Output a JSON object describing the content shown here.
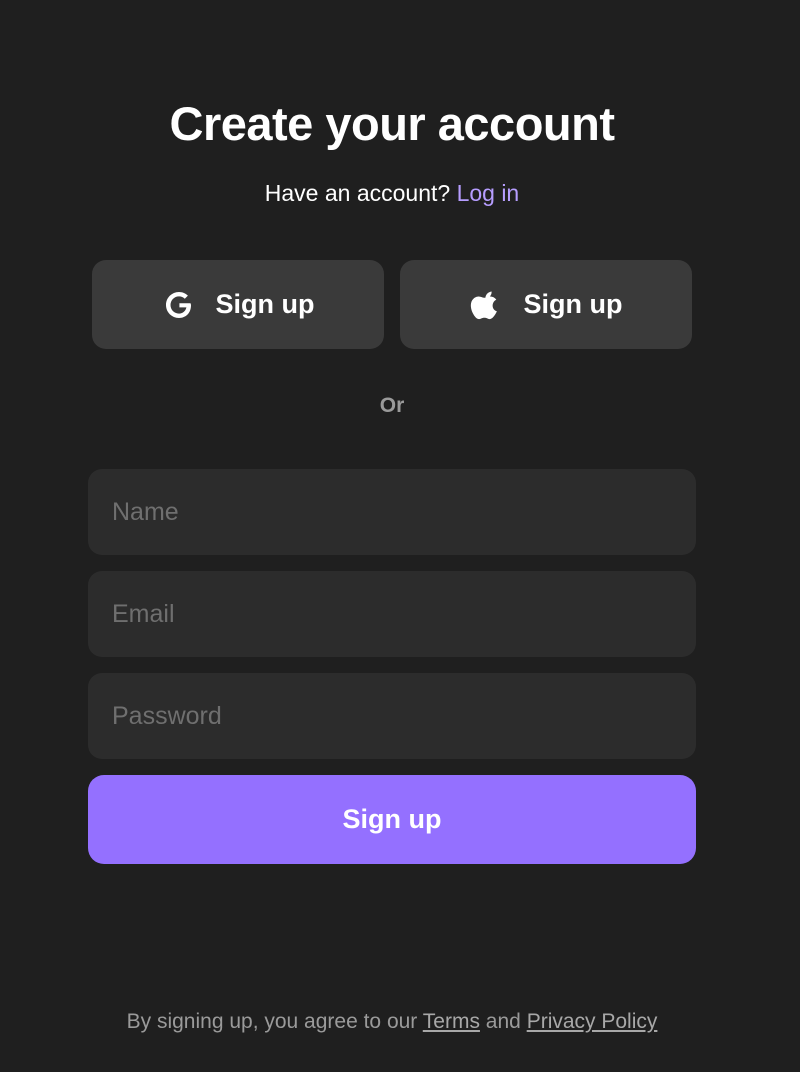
{
  "header": {
    "title": "Create your account",
    "subtitle_prefix": "Have an account?",
    "login_link": "Log in"
  },
  "social": {
    "google": {
      "label": "Sign up",
      "icon": "google-icon"
    },
    "apple": {
      "label": "Sign up",
      "icon": "apple-icon"
    }
  },
  "divider_text": "Or",
  "form": {
    "name": {
      "placeholder": "Name",
      "value": ""
    },
    "email": {
      "placeholder": "Email",
      "value": ""
    },
    "password": {
      "placeholder": "Password",
      "value": ""
    },
    "submit_label": "Sign up"
  },
  "legal": {
    "prefix": "By signing up, you agree to our",
    "terms": "Terms",
    "and": "and",
    "privacy": "Privacy Policy"
  },
  "colors": {
    "background": "#1f1f1f",
    "accent": "#9470ff",
    "link": "#b69dff",
    "social_button": "#3a3a3a",
    "input_background": "#2c2c2c"
  }
}
